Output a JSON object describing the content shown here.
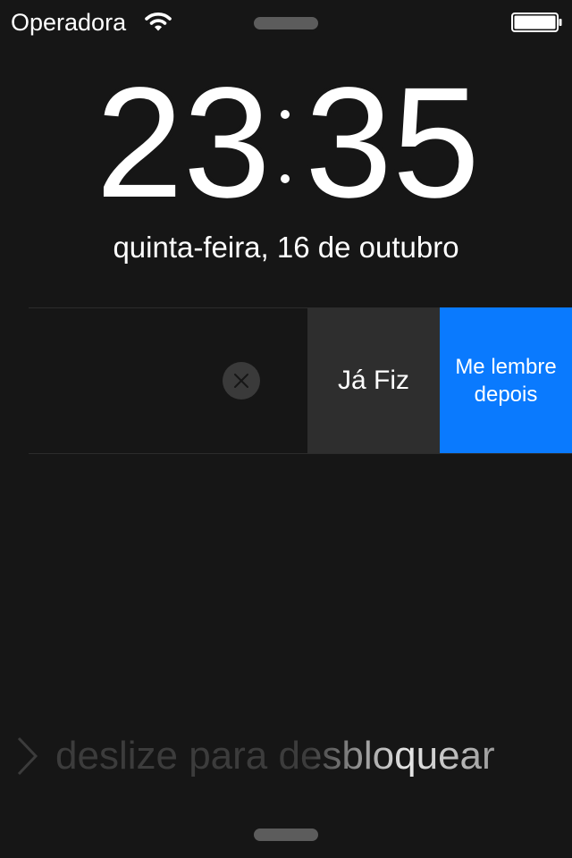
{
  "status_bar": {
    "carrier": "Operadora"
  },
  "clock": {
    "hours": "23",
    "separator": ":",
    "minutes": "35"
  },
  "date": "quinta-feira, 16 de outubro",
  "notification": {
    "actions": {
      "done_label": "Já Fiz",
      "remind_line1": "Me lembre",
      "remind_line2": "depois"
    },
    "accent_color": "#0a7afe"
  },
  "unlock": {
    "text": "deslize para desbloquear"
  },
  "icons": [
    "wifi-icon",
    "battery-icon",
    "close-icon",
    "chevron-right-icon"
  ]
}
